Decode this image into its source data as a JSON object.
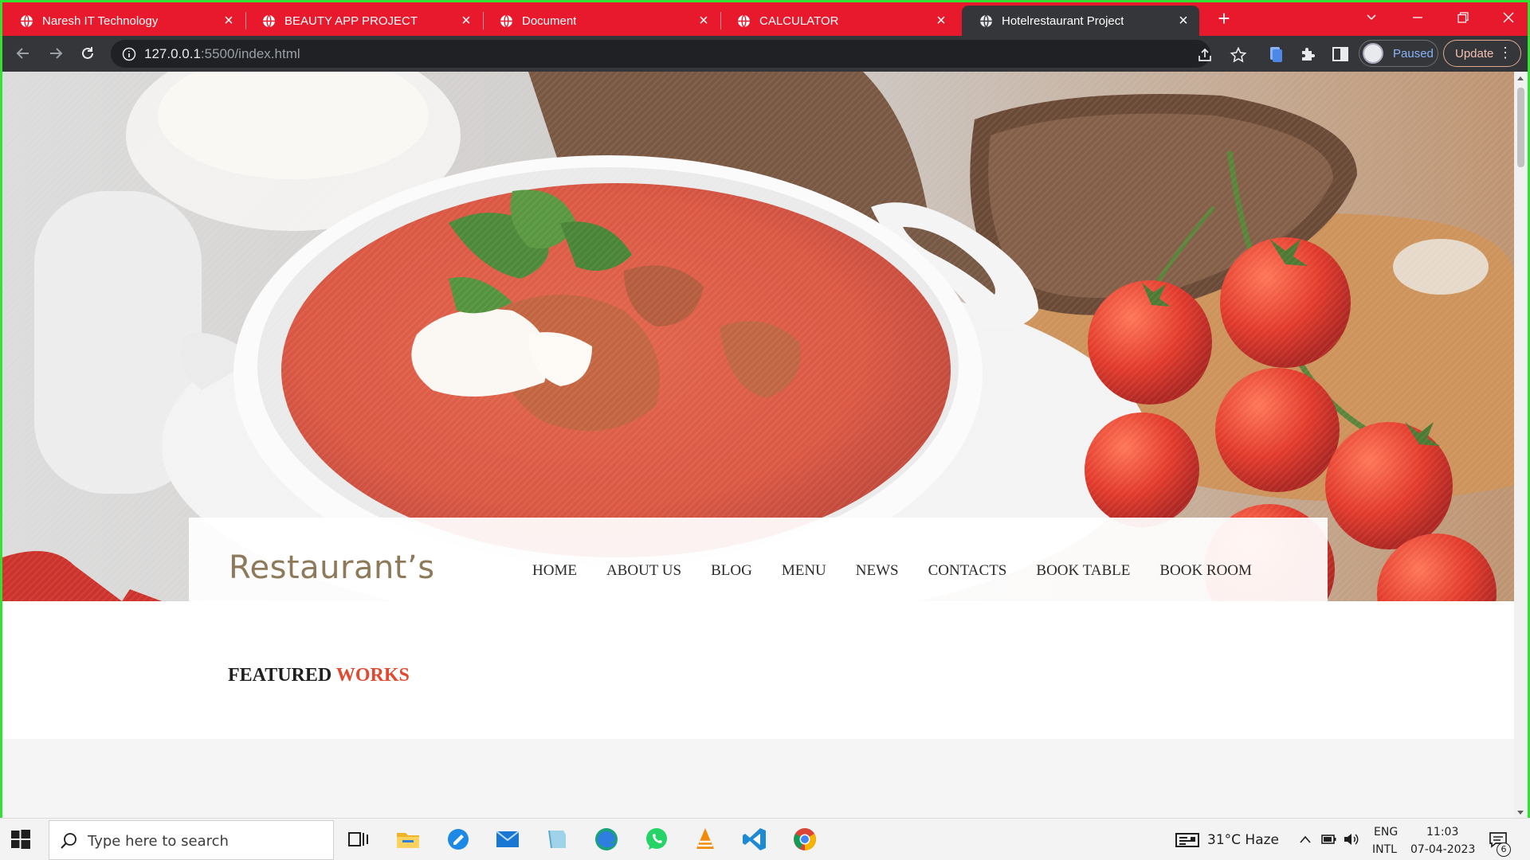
{
  "browser": {
    "tabs": [
      {
        "title": "Naresh IT Technology",
        "active": false
      },
      {
        "title": "BEAUTY APP PROJECT",
        "active": false
      },
      {
        "title": "Document",
        "active": false
      },
      {
        "title": "CALCULATOR",
        "active": false
      },
      {
        "title": "Hotelrestaurant Project",
        "active": true
      }
    ],
    "close_glyph": "×",
    "new_tab_glyph": "+",
    "address": {
      "host": "127.0.0.1",
      "rest": ":5500/index.html"
    },
    "profile_status": "Paused",
    "update_label": "Update",
    "menu_glyph": "⋮"
  },
  "site": {
    "brand": "Restaurant’s",
    "menu": [
      "HOME",
      "ABOUT US",
      "BLOG",
      "MENU",
      "NEWS",
      "CONTACTS",
      "BOOK TABLE",
      "BOOK ROOM"
    ],
    "featured_title_dark": "FEATURED",
    "featured_title_accent": "WORKS"
  },
  "taskbar": {
    "search_placeholder": "Type here to search",
    "weather": "31°C  Haze",
    "language_top": "ENG",
    "language_bottom": "INTL",
    "time": "11:03",
    "date": "07-04-2023",
    "notification_count": "6"
  },
  "colors": {
    "tab_strip": "#e8192c",
    "toolbar": "#35363a",
    "featured_accent": "#e2492f",
    "brand_text": "#8e7a5a",
    "window_border": "#35e035"
  }
}
